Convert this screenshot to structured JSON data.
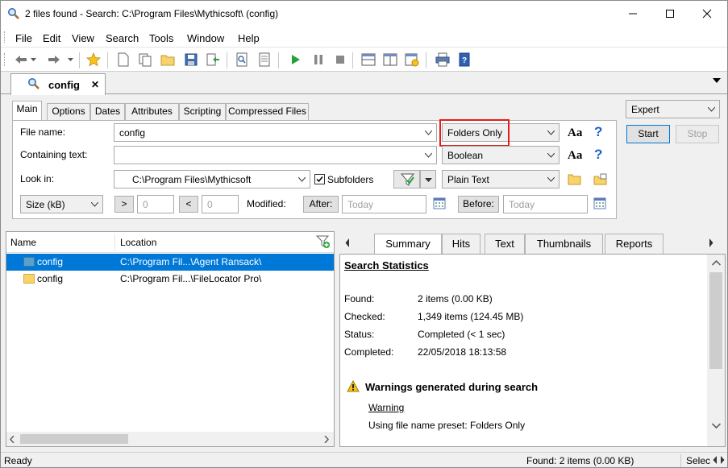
{
  "window": {
    "title": "2 files found - Search: C:\\Program Files\\Mythicsoft\\ (config)"
  },
  "menu": [
    "File",
    "Edit",
    "View",
    "Search",
    "Tools",
    "Window",
    "Help"
  ],
  "doc_tab": {
    "label": "config",
    "close": "✕"
  },
  "criteria": {
    "tabs": [
      "Main",
      "Options",
      "Dates",
      "Attributes",
      "Scripting",
      "Compressed Files"
    ],
    "file_name_label": "File name:",
    "file_name_value": "config",
    "containing_text_label": "Containing text:",
    "containing_text_value": "",
    "look_in_label": "Look in:",
    "look_in_value": "C:\\Program Files\\Mythicsoft",
    "subfolders_label": "Subfolders",
    "subfolders_checked": true,
    "file_mode": "Folders Only",
    "text_mode": "Boolean",
    "content_mode": "Plain Text",
    "size_unit": "Size (kB)",
    "size_gt": ">",
    "size_gt_value": "0",
    "size_lt": "<",
    "size_lt_value": "0",
    "modified_label": "Modified:",
    "after_label": "After:",
    "after_placeholder": "Today",
    "before_label": "Before:",
    "before_placeholder": "Today",
    "aa": "Aa",
    "help": "?"
  },
  "right_panel": {
    "mode": "Expert",
    "start": "Start",
    "stop": "Stop"
  },
  "results": {
    "columns": [
      "Name",
      "Location"
    ],
    "rows": [
      {
        "name": "config",
        "location": "C:\\Program Fil...\\Agent Ransack\\",
        "selected": true
      },
      {
        "name": "config",
        "location": "C:\\Program Fil...\\FileLocator Pro\\",
        "selected": false
      }
    ]
  },
  "preview": {
    "tabs": [
      "Summary",
      "Hits",
      "Text",
      "Thumbnails",
      "Reports"
    ],
    "heading": "Search Statistics",
    "stats": [
      {
        "key": "Found:",
        "value": "2 items (0.00 KB)"
      },
      {
        "key": "Checked:",
        "value": "1,349 items (124.45 MB)"
      },
      {
        "key": "Status:",
        "value": "Completed (< 1 sec)"
      },
      {
        "key": "Completed:",
        "value": "22/05/2018 18:13:58"
      }
    ],
    "warnings_heading": "Warnings generated during search",
    "warning_link": "Warning",
    "warning_text": "Using file name preset: Folders Only"
  },
  "status": {
    "left": "Ready",
    "found": "Found: 2 items (0.00 KB)",
    "right": "Selec"
  },
  "colors": {
    "selection": "#0078d7",
    "highlight_box": "#e51b1b",
    "help_blue": "#1d5fd1"
  }
}
